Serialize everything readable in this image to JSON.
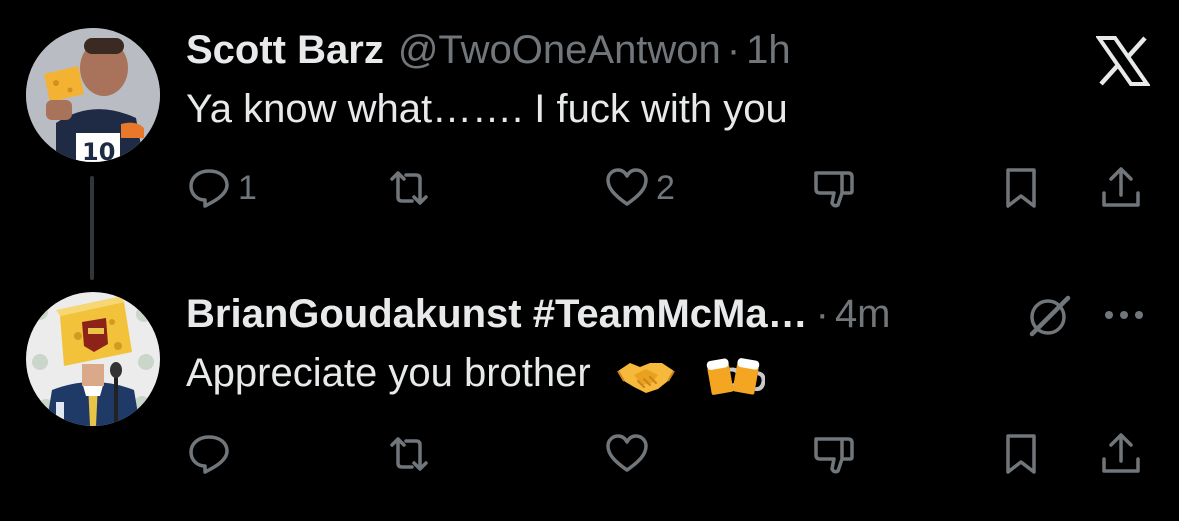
{
  "tweets": [
    {
      "display_name": "Scott Barz",
      "handle": "@TwoOneAntwon",
      "separator": "·",
      "time": "1h",
      "text": "Ya know what……. I fuck with you",
      "emoji": [],
      "reply_count": "1",
      "retweet_count": "",
      "like_count": "2",
      "avatar_icon": "football-fan-avatar"
    },
    {
      "display_name": "BrianGoudakunst #TeamMcMa…",
      "handle": "",
      "separator": "·",
      "time": "4m",
      "text": "Appreciate you brother",
      "emoji": [
        "handshake-emoji",
        "beer-mugs-emoji"
      ],
      "reply_count": "",
      "retweet_count": "",
      "like_count": "",
      "avatar_icon": "cheese-head-speaker-avatar"
    }
  ],
  "icons": {
    "reply": "reply-icon",
    "retweet": "retweet-icon",
    "like": "heart-icon",
    "dislike": "dislike-icon",
    "bookmark": "bookmark-icon",
    "share": "share-icon",
    "brand": "x-logo-icon",
    "grok": "grok-icon",
    "more": "more-options-icon"
  },
  "colors": {
    "background": "#000000",
    "primary_text": "#e7e9ea",
    "secondary_text": "#71767b",
    "thread_line": "#333639"
  }
}
